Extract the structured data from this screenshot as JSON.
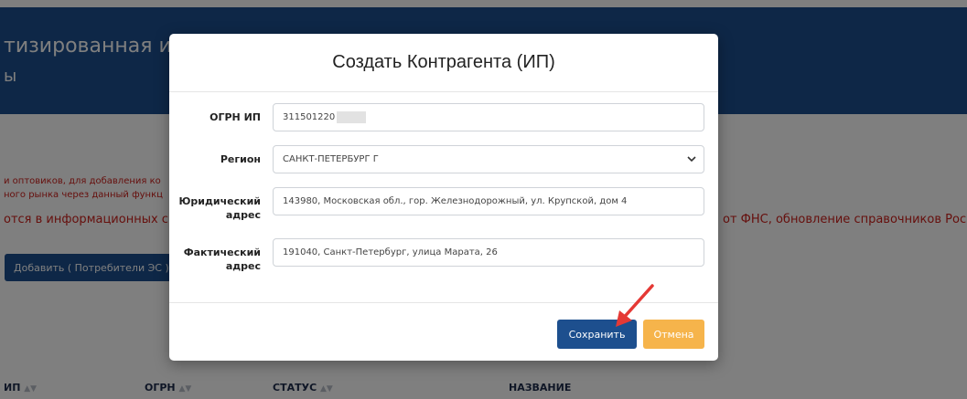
{
  "background": {
    "title": "тизированная инфо",
    "subtitle": "ы",
    "warning_line1": "и оптовиков, для добавления ко",
    "warning_line2": "ного рынка через данный функц",
    "warning_line3_left": "отся в информационных си",
    "warning_line3_right": "от ФНС, обновление справочников Рос",
    "add_button": "Добавить ( Потребители ЭС )",
    "columns": [
      "ИП",
      "ОГРН",
      "СТАТУС",
      "НАЗВАНИЕ"
    ]
  },
  "modal": {
    "title": "Создать Контрагента (ИП)",
    "fields": [
      {
        "label": "ОГРН ИП",
        "value": "311501220"
      },
      {
        "label": "Регион",
        "value": "САНКТ-ПЕТЕРБУРГ Г"
      },
      {
        "label": "Юридический адрес",
        "value": "143980, Московская обл., гор. Железнодорожный, ул. Крупской, дом 4"
      },
      {
        "label": "Фактический адрес",
        "value": "191040, Санкт-Петербург, улица Марата, 26"
      }
    ],
    "save_label": "Сохранить",
    "cancel_label": "Отмена"
  },
  "colors": {
    "primary": "#1d4f8e",
    "warning_text": "#cc1f1a",
    "cancel": "#f6b44b",
    "annotation_arrow": "#e53935"
  },
  "icons": {
    "select": "chevron-down-icon",
    "annotation": "red-arrow-icon"
  }
}
